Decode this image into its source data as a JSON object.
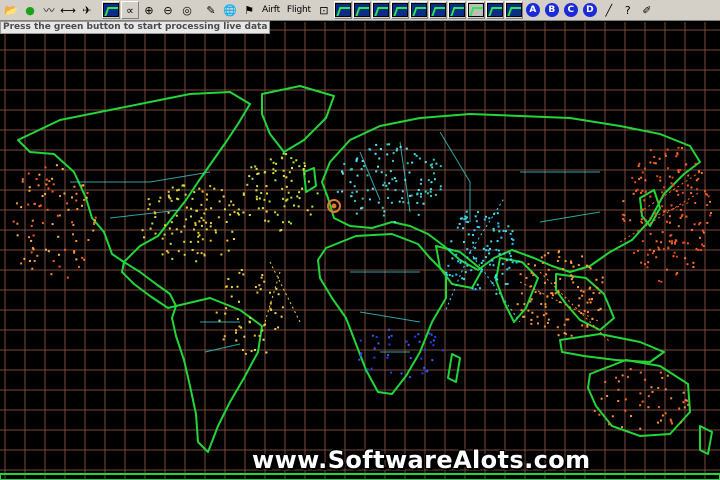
{
  "toolbar": {
    "buttons": [
      {
        "id": "open",
        "icon": "folder-icon",
        "glyph": "📂"
      },
      {
        "id": "start-green",
        "icon": "green-circle-icon",
        "glyph": "●",
        "color": "#1aa31a"
      },
      {
        "id": "wave",
        "icon": "wave-icon",
        "glyph": "〰"
      },
      {
        "id": "range",
        "icon": "range-icon",
        "glyph": "⟷"
      },
      {
        "id": "aircraft",
        "icon": "aircraft-icon",
        "glyph": "✈"
      },
      {
        "id": "map-view",
        "icon": "map-view-icon",
        "glyph": "map"
      },
      {
        "id": "zoom-tool",
        "icon": "zoom-tool-icon",
        "glyph": "∝"
      },
      {
        "id": "zoom-in",
        "icon": "zoom-in-icon",
        "glyph": "⊕"
      },
      {
        "id": "zoom-out",
        "icon": "zoom-out-icon",
        "glyph": "⊖"
      },
      {
        "id": "target",
        "icon": "target-icon",
        "glyph": "◎"
      },
      {
        "id": "draw",
        "icon": "draw-icon",
        "glyph": "✎"
      },
      {
        "id": "globe",
        "icon": "globe-icon",
        "glyph": "🌐"
      },
      {
        "id": "transmitter",
        "icon": "transmitter-icon",
        "glyph": "⚑"
      }
    ],
    "text_labels": [
      "Airft",
      "Flight"
    ],
    "map_buttons_count": 7,
    "layer_buttons_count": 3,
    "letters": [
      "A",
      "B",
      "C",
      "D"
    ],
    "tail_buttons": [
      {
        "id": "pen",
        "icon": "pen-icon",
        "glyph": "╱"
      },
      {
        "id": "help",
        "icon": "help-icon",
        "glyph": "?"
      },
      {
        "id": "pencil",
        "icon": "pencil-icon",
        "glyph": "✐"
      }
    ]
  },
  "status": {
    "message": "Press the green button to start processing live data"
  },
  "map": {
    "background": "#000000",
    "grid_color": "#7a4a3c",
    "coast_color": "#22d63a",
    "border_color": "#3fd8d8",
    "marker_color": "#e07a2c"
  },
  "watermark": {
    "text": "www.SoftwareAlots.com"
  }
}
